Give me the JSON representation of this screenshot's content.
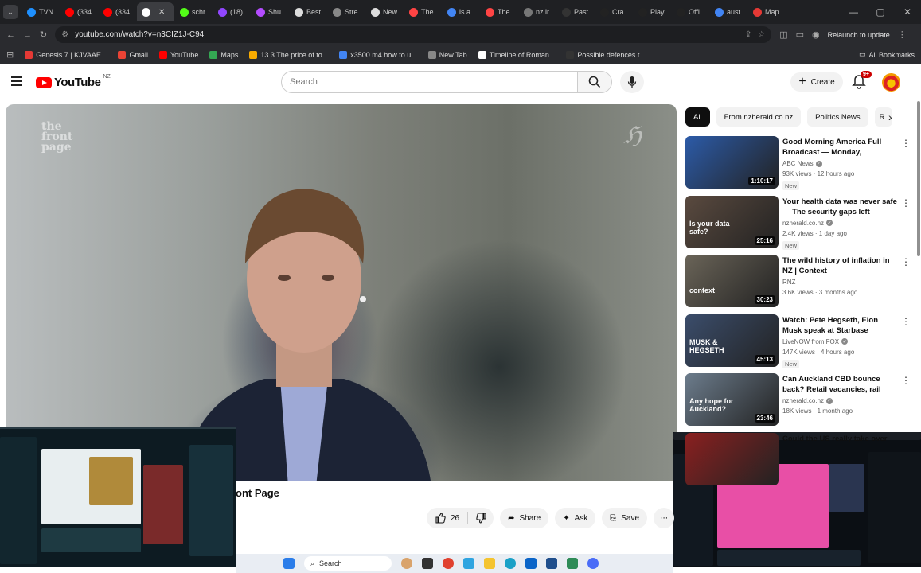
{
  "browser": {
    "tabs": [
      {
        "label": "TVN",
        "color": "#1e90ff"
      },
      {
        "label": "(334",
        "color": "#ff0000"
      },
      {
        "label": "(334",
        "color": "#ff0000"
      },
      {
        "label": "",
        "color": "#ffffff",
        "active": true
      },
      {
        "label": "schr",
        "color": "#53fc18"
      },
      {
        "label": "(18)",
        "color": "#9146ff"
      },
      {
        "label": "Shu",
        "color": "#b44cff"
      },
      {
        "label": "Best",
        "color": "#dddddd"
      },
      {
        "label": "Stre",
        "color": "#888888"
      },
      {
        "label": "New",
        "color": "#dddddd"
      },
      {
        "label": "The",
        "color": "#ff4444"
      },
      {
        "label": "is a",
        "color": "#4285f4"
      },
      {
        "label": "The",
        "color": "#ff4444"
      },
      {
        "label": "nz ir",
        "color": "#777777"
      },
      {
        "label": "Past",
        "color": "#333333"
      },
      {
        "label": "Cra",
        "color": "#222222"
      },
      {
        "label": "Play",
        "color": "#222222"
      },
      {
        "label": "Offi",
        "color": "#222222"
      },
      {
        "label": "aust",
        "color": "#4285f4"
      },
      {
        "label": "Map",
        "color": "#e53935"
      }
    ],
    "url": "youtube.com/watch?v=n3CIZ1J-C94",
    "relaunch_label": "Relaunch to update",
    "bookmarks": [
      {
        "label": "Genesis 7 | KJVAAE...",
        "color": "#e53935"
      },
      {
        "label": "Gmail",
        "color": "#ea4335"
      },
      {
        "label": "YouTube",
        "color": "#ff0000"
      },
      {
        "label": "Maps",
        "color": "#34a853"
      },
      {
        "label": "13.3 The price of to...",
        "color": "#f9ab00"
      },
      {
        "label": "x3500 m4 how to u...",
        "color": "#4285f4"
      },
      {
        "label": "New Tab",
        "color": "#888888"
      },
      {
        "label": "Timeline of Roman...",
        "color": "#ffffff"
      },
      {
        "label": "Possible defences t...",
        "color": "#333333"
      }
    ],
    "all_bookmarks_label": "All Bookmarks"
  },
  "youtube": {
    "logo_text": "YouTube",
    "country_code": "NZ",
    "search_placeholder": "Search",
    "create_label": "Create",
    "notification_badge": "9+",
    "video": {
      "watermark": "the front page",
      "title": "ont Page",
      "likes": "26",
      "share_label": "Share",
      "ask_label": "Ask",
      "save_label": "Save"
    },
    "chips": [
      "All",
      "From nzherald.co.nz",
      "Politics News",
      "R"
    ],
    "recommendations": [
      {
        "title": "Good Morning America Full Broadcast — Monday, January...",
        "channel": "ABC News",
        "verified": true,
        "meta": "93K views · 12 hours ago",
        "badge": "New",
        "duration": "1:10:17",
        "thumb_color": "#2c5ba8"
      },
      {
        "title": "Your health data was never safe — The security gaps left unfixe...",
        "channel": "nzherald.co.nz",
        "verified": true,
        "meta": "2.4K views · 1 day ago",
        "badge": "New",
        "duration": "25:16",
        "thumb_color": "#5a4a3f",
        "thumb_text": "Is your data safe?"
      },
      {
        "title": "The wild history of inflation in NZ | Context",
        "channel": "RNZ",
        "verified": false,
        "meta": "3.6K views · 3 months ago",
        "badge": "",
        "duration": "30:23",
        "thumb_color": "#6a6458",
        "thumb_text": "context"
      },
      {
        "title": "Watch: Pete Hegseth, Elon Musk speak at Starbase",
        "channel": "LiveNOW from FOX",
        "verified": true,
        "meta": "147K views · 4 hours ago",
        "badge": "New",
        "duration": "45:13",
        "thumb_color": "#3b4d6b",
        "thumb_text": "MUSK & HEGSETH"
      },
      {
        "title": "Can Auckland CBD bounce back? Retail vacancies, rail lin...",
        "channel": "nzherald.co.nz",
        "verified": true,
        "meta": "18K views · 1 month ago",
        "badge": "",
        "duration": "23:46",
        "thumb_color": "#6c7c8c",
        "thumb_text": "Any hope for Auckland?"
      },
      {
        "title": "Could the US really take over",
        "channel": "",
        "verified": false,
        "meta": "",
        "badge": "",
        "duration": "",
        "thumb_color": "#8a2020"
      }
    ]
  },
  "taskbar": {
    "search_label": "Search"
  }
}
